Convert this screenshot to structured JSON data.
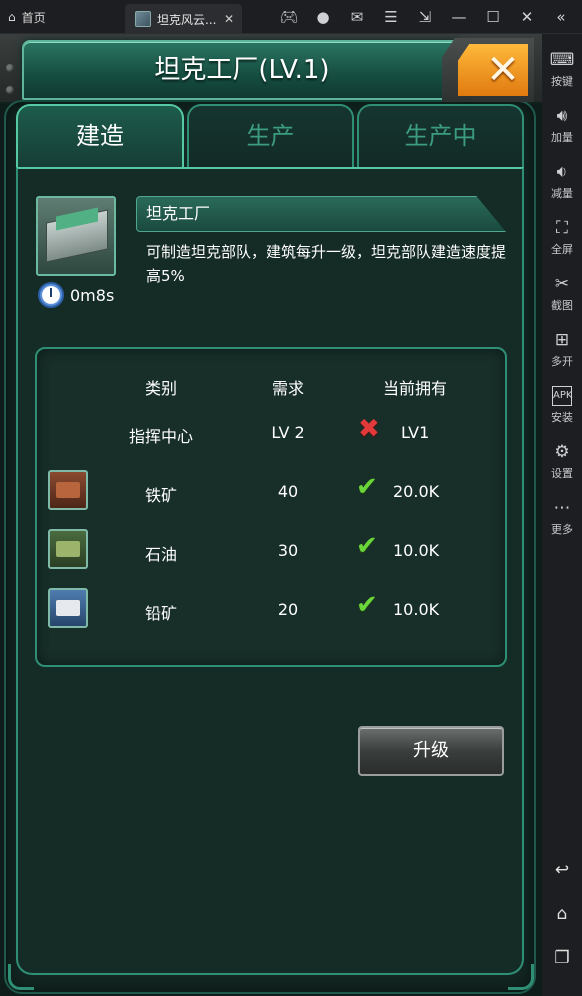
{
  "emulator": {
    "home_label": "首页",
    "tab_title": "坦克风云...",
    "tab_close": "✕",
    "toolbar_icons": [
      "gamepad-icon",
      "user-icon",
      "mail-icon",
      "menu-icon",
      "export-icon",
      "minimize-icon",
      "maximize-icon",
      "close-icon",
      "collapse-icon"
    ],
    "sidebar": [
      {
        "icon": "keyboard-icon",
        "label": "按键"
      },
      {
        "icon": "volume-up-icon",
        "label": "加量"
      },
      {
        "icon": "volume-down-icon",
        "label": "减量"
      },
      {
        "icon": "fullscreen-icon",
        "label": "全屏"
      },
      {
        "icon": "scissors-icon",
        "label": "截图"
      },
      {
        "icon": "multi-open-icon",
        "label": "多开"
      },
      {
        "icon": "apk-icon",
        "label": "安装"
      },
      {
        "icon": "gear-icon",
        "label": "设置"
      },
      {
        "icon": "more-icon",
        "label": "更多"
      }
    ],
    "nav": [
      "back-icon",
      "home-icon",
      "recent-apps-icon"
    ]
  },
  "dialog": {
    "title": "坦克工厂(LV.1)",
    "tabs": [
      {
        "label": "建造",
        "active": true
      },
      {
        "label": "生产",
        "active": false
      },
      {
        "label": "生产中",
        "active": false
      }
    ],
    "building": {
      "name": "坦克工厂",
      "description": "可制造坦克部队，建筑每升一级，坦克部队建造速度提高5%",
      "build_time": "0m8s"
    },
    "requirements": {
      "headers": {
        "category": "类别",
        "need": "需求",
        "current": "当前拥有"
      },
      "rows": [
        {
          "icon": "",
          "name": "指挥中心",
          "need": "LV 2",
          "have": "LV1",
          "met": false
        },
        {
          "icon": "iron-ore-icon",
          "name": "铁矿",
          "need": "40",
          "have": "20.0K",
          "met": true
        },
        {
          "icon": "oil-icon",
          "name": "石油",
          "need": "30",
          "have": "10.0K",
          "met": true
        },
        {
          "icon": "lead-ore-icon",
          "name": "铅矿",
          "need": "20",
          "have": "10.0K",
          "met": true
        }
      ]
    },
    "upgrade_label": "升级",
    "colors": {
      "accent": "#2f8f74",
      "close": "#f29a1f",
      "ok": "#6bd63a",
      "fail": "#e23a3a"
    }
  }
}
